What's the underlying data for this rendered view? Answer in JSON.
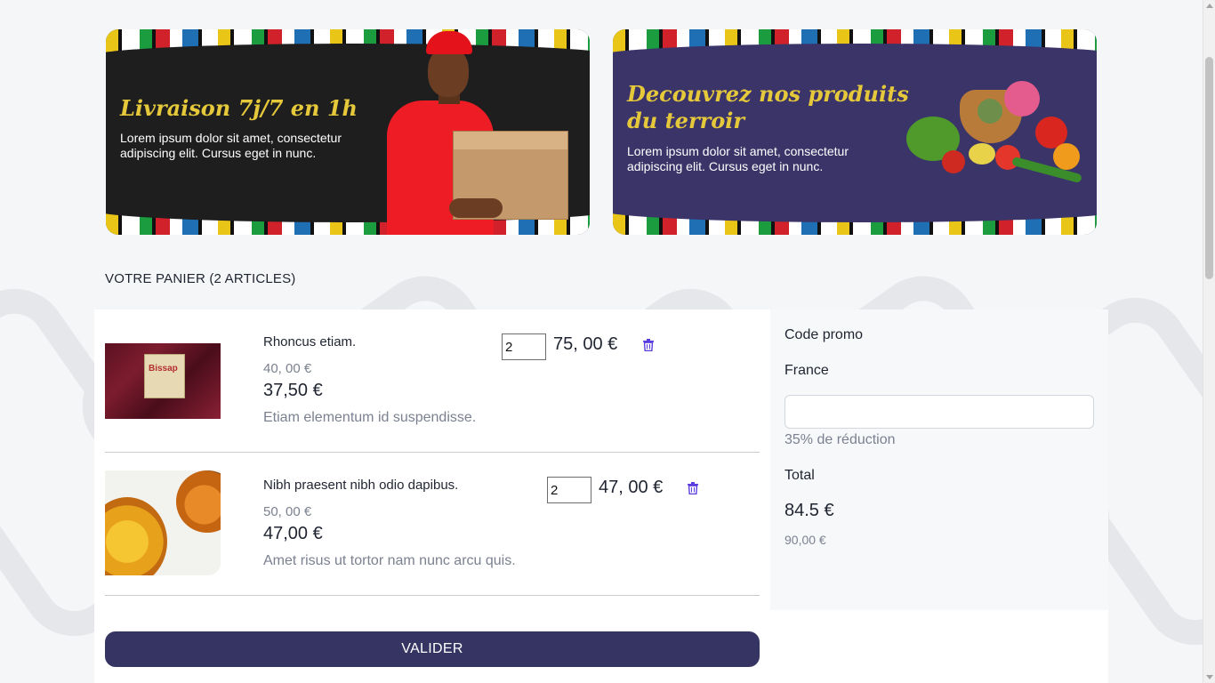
{
  "banners": [
    {
      "title": "Livraison 7j/7 en 1h",
      "text": "Lorem ipsum dolor sit amet, consectetur adipiscing elit. Cursus eget in nunc."
    },
    {
      "title": "Decouvrez nos produits du terroir",
      "text": "Lorem ipsum dolor sit amet, consectetur adipiscing elit. Cursus eget in nunc."
    }
  ],
  "cart": {
    "title": "VOTRE PANIER (2 ARTICLES)",
    "items": [
      {
        "name": "Rhoncus etiam.",
        "old_price": "40, 00 €",
        "price": "37,50 €",
        "description": "Etiam elementum id suspendisse.",
        "quantity": "2",
        "line_total": "75, 00 €",
        "image_label": "Bissap"
      },
      {
        "name": "Nibh praesent nibh odio dapibus.",
        "old_price": "50, 00 €",
        "price": "47,00 €",
        "description": "Amet risus ut tortor nam nunc arcu quis.",
        "quantity": "2",
        "line_total": "47, 00 €"
      }
    ],
    "validate_label": "VALIDER"
  },
  "summary": {
    "promo_label": "Code promo",
    "country": "France",
    "promo_value": "",
    "discount_text": "35% de réduction",
    "total_label": "Total",
    "total_value": "84.5 €",
    "total_old": "90,00 €"
  },
  "colors": {
    "primary": "#363462",
    "banner_title": "#e6c93a",
    "trash_icon": "#5b3ce0"
  },
  "icons": {
    "delete": "trash-icon"
  }
}
